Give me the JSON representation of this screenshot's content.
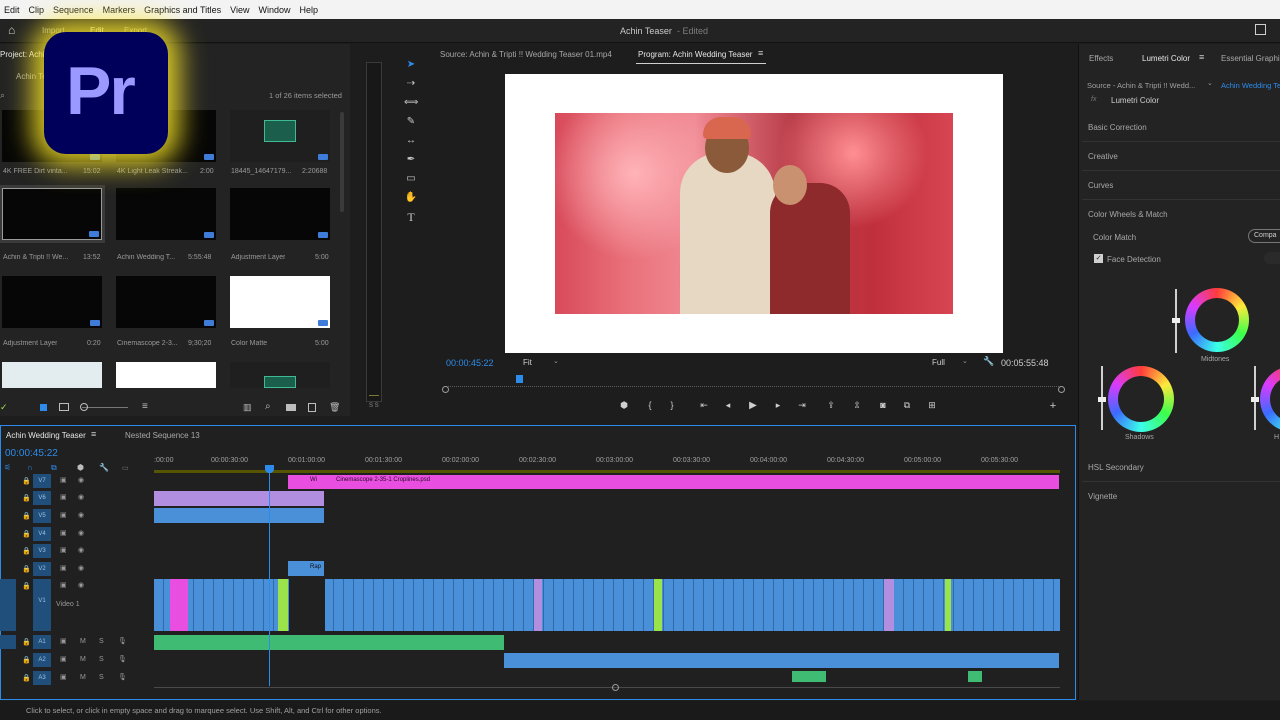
{
  "menu": [
    "Edit",
    "Clip",
    "Sequence",
    "Markers",
    "Graphics and Titles",
    "View",
    "Window",
    "Help"
  ],
  "header": {
    "workspaces": [
      "Import",
      "Edit",
      "Export"
    ],
    "title": "Achin Teaser",
    "title_suffix": "- Edited"
  },
  "project": {
    "title": "Project: Achin T",
    "tab2": "Achin Te",
    "items_selected": "1 of 26 items selected",
    "items": [
      {
        "name": "4K FREE Dirt vinta...",
        "dur": "15:02",
        "kind": "black"
      },
      {
        "name": "4K Light Leak Streak...",
        "dur": "2:00",
        "kind": "black"
      },
      {
        "name": "18445_14647179...",
        "dur": "2:20688",
        "kind": "audio"
      },
      {
        "name": "Achin & Tripti !! We...",
        "dur": "13:52",
        "kind": "black"
      },
      {
        "name": "Achin Wedding T...",
        "dur": "5:55:48",
        "kind": "black"
      },
      {
        "name": "Adjustment Layer",
        "dur": "5:00",
        "kind": "black"
      },
      {
        "name": "Adjustment Layer",
        "dur": "0:20",
        "kind": "black"
      },
      {
        "name": "Cinemascope 2-3...",
        "dur": "9;30;20",
        "kind": "black"
      },
      {
        "name": "Color Matte",
        "dur": "5:00",
        "kind": "white"
      }
    ]
  },
  "source": {
    "tab": "Source: Achin & Tripti !! Wedding Teaser 01.mp4"
  },
  "program": {
    "tab": "Program: Achin Wedding Teaser",
    "timecode": "00:00:45:22",
    "fit": "Fit",
    "quality": "Full",
    "duration": "00:05:55:48"
  },
  "lumetri": {
    "tabs": [
      "Effects",
      "Lumetri Color",
      "Essential Graphic"
    ],
    "source": "Source - Achin & Tripti !! Wedd...",
    "target": "Achin Wedding Te",
    "fx": "Lumetri Color",
    "sections": [
      "Basic Correction",
      "Creative",
      "Curves",
      "Color Wheels & Match"
    ],
    "color_match": "Color Match",
    "compare": "Compa",
    "face_detection": "Face Detection",
    "wheels": [
      "Midtones",
      "Shadows",
      "H"
    ],
    "bottom_sections": [
      "HSL Secondary",
      "Vignette"
    ]
  },
  "timeline": {
    "tab": "Achin Wedding Teaser",
    "tab2": "Nested Sequence 13",
    "timecode": "00:00:45:22",
    "ruler": [
      ":00:00",
      "00:00:30:00",
      "00:01:00:00",
      "00:01:30:00",
      "00:02:00:00",
      "00:02:30:00",
      "00:03:00:00",
      "00:03:30:00",
      "00:04:00:00",
      "00:04:30:00",
      "00:05:00:00",
      "00:05:30:00"
    ],
    "video_tracks": [
      "V7",
      "V6",
      "V5",
      "V4",
      "V3",
      "V2",
      "V1"
    ],
    "v1_name": "Video 1",
    "audio_tracks": [
      "A1",
      "A2",
      "A3"
    ],
    "clip_wi": "Wi",
    "clip_cinemascope": "Cinemascope 2-35-1 Croplines.psd",
    "clip_rap": "Rap"
  },
  "status": "Click to select, or click in empty space and drag to marquee select. Use Shift, Alt, and Ctrl for other options.",
  "logo": "Pr",
  "colors": {
    "accent": "#2d8ceb",
    "logo_bg": "#00005b",
    "logo_text": "#9999ff",
    "magenta": "#e84fe0",
    "clip_blue": "#4a90d9",
    "clip_green": "#3fbb74",
    "clip_lime": "#9ae34a",
    "clip_purple": "#b28ee0"
  }
}
